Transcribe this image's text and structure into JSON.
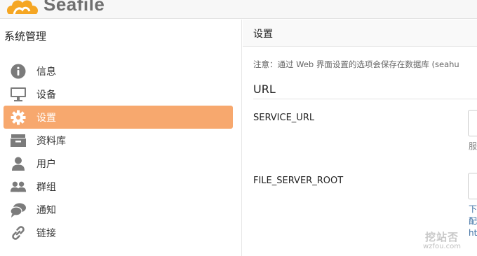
{
  "header": {
    "logo_text": "Seafile"
  },
  "sidebar": {
    "title": "系统管理",
    "items": [
      {
        "label": "信息",
        "icon": "info-icon",
        "active": false
      },
      {
        "label": "设备",
        "icon": "monitor-icon",
        "active": false
      },
      {
        "label": "设置",
        "icon": "gear-icon",
        "active": true
      },
      {
        "label": "资料库",
        "icon": "archive-icon",
        "active": false
      },
      {
        "label": "用户",
        "icon": "user-icon",
        "active": false
      },
      {
        "label": "群组",
        "icon": "group-icon",
        "active": false
      },
      {
        "label": "通知",
        "icon": "chat-icon",
        "active": false
      },
      {
        "label": "链接",
        "icon": "link-icon",
        "active": false
      }
    ]
  },
  "main": {
    "title": "设置",
    "notice": "注意：通过 Web 界面设置的选项会保存在数据库 (seahu",
    "section_title": "URL",
    "fields": [
      {
        "label": "SERVICE_URL",
        "help_lines": [
          "服"
        ]
      },
      {
        "label": "FILE_SERVER_ROOT",
        "help_lines": [
          "下",
          "配",
          "htt"
        ]
      }
    ]
  },
  "watermark": {
    "title": "挖站否",
    "subtitle": "wzfou.com"
  },
  "colors": {
    "accent": "#f7a86e",
    "icon_gray": "#7b7b7b",
    "logo_orange": "#f5a623"
  }
}
